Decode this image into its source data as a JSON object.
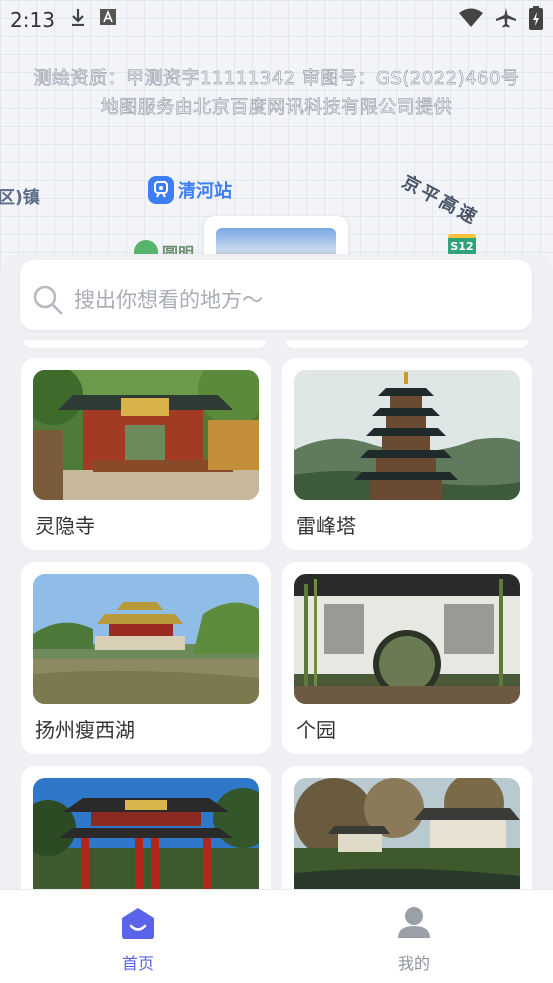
{
  "status_bar": {
    "time": "2:13"
  },
  "map": {
    "credit_line1": "测绘资质：甲测资字11111342   审图号：GS(2022)460号",
    "credit_line2": "地图服务由北京百度网讯科技有限公司提供",
    "place_left": "区)镇",
    "station_name": "清河站",
    "highway_name": "京平高速",
    "highway_shield": "S12",
    "poi_partial": "圆明"
  },
  "search": {
    "placeholder": "搜出你想看的地方～"
  },
  "attractions": [
    {
      "name": "灵隐寺"
    },
    {
      "name": "雷峰塔"
    },
    {
      "name": "扬州瘦西湖"
    },
    {
      "name": "个园"
    },
    {
      "name": ""
    },
    {
      "name": ""
    }
  ],
  "tabbar": {
    "home_label": "首页",
    "mine_label": "我的"
  },
  "colors": {
    "accent": "#5b64e8",
    "station": "#3d7df5",
    "inactive": "#8e939c"
  }
}
